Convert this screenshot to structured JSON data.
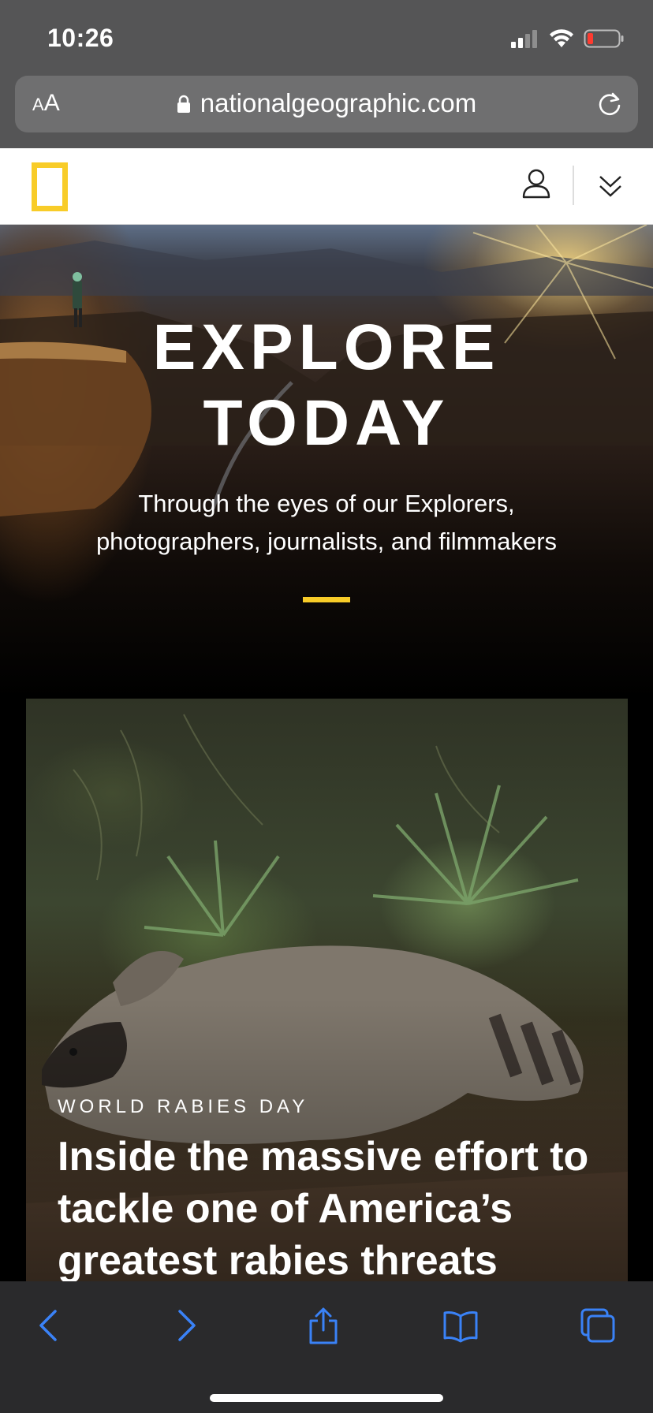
{
  "status_bar": {
    "time": "10:26",
    "icons": [
      "cellular-signal-icon",
      "wifi-icon",
      "battery-low-icon"
    ]
  },
  "browser": {
    "text_size_label_small": "A",
    "text_size_label_large": "A",
    "url": "nationalgeographic.com",
    "icons": [
      "lock-icon",
      "reload-icon"
    ],
    "toolbar": [
      "back-icon",
      "forward-icon",
      "share-icon",
      "bookmarks-icon",
      "tabs-icon"
    ],
    "accent_color": "#3a82f7"
  },
  "site_header": {
    "brand_color": "#f8cc28",
    "icons": [
      "yellow-border-logo",
      "user-icon",
      "chevron-down-icon"
    ]
  },
  "hero": {
    "title_line1": "EXPLORE",
    "title_line2": "TODAY",
    "subtitle_line1": "Through the eyes of our Explorers,",
    "subtitle_line2": "photographers, journalists, and filmmakers"
  },
  "article": {
    "kicker": "WORLD RABIES DAY",
    "headline": "Inside the massive effort to tackle one of America’s greatest rabies threats"
  }
}
